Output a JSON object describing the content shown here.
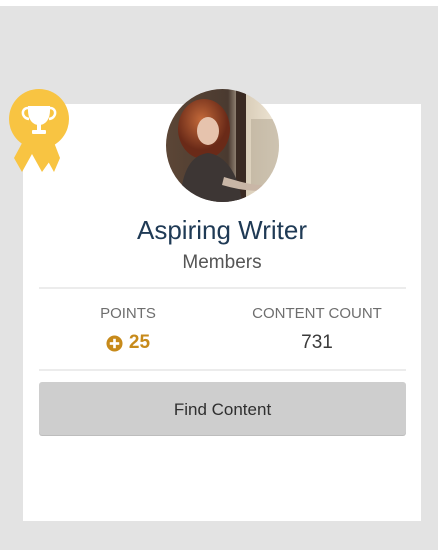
{
  "profile": {
    "name": "Aspiring Writer",
    "group": "Members"
  },
  "stats": {
    "points_label": "POINTS",
    "points_value": "25",
    "content_label": "CONTENT COUNT",
    "content_value": "731"
  },
  "actions": {
    "find_content": "Find Content"
  },
  "icons": {
    "award": "trophy-ribbon-icon",
    "points": "plus-circle-icon"
  },
  "colors": {
    "award": "#f8c442",
    "points": "#c78a1a",
    "name": "#1f3a55",
    "button": "#cecece"
  }
}
